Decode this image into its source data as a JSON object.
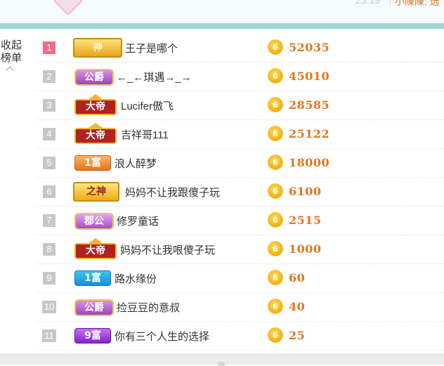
{
  "header": {
    "time": "23:19",
    "user": "小陳陳: 选"
  },
  "collapse": {
    "line1": "收起",
    "line2": "榜单"
  },
  "rows": [
    {
      "rank": "1",
      "badge": "神",
      "badge_type": "gold",
      "name": "王子是哪个",
      "score": "52035"
    },
    {
      "rank": "2",
      "badge": "公爵",
      "badge_type": "gong",
      "name": "←_←琪遇→_→",
      "score": "45010"
    },
    {
      "rank": "3",
      "badge": "大帝",
      "badge_type": "dadi",
      "name": "Lucifer傲飞",
      "score": "28585"
    },
    {
      "rank": "4",
      "badge": "大帝",
      "badge_type": "dadi",
      "name": "吉祥哥111",
      "score": "25122"
    },
    {
      "rank": "5",
      "badge": "1富",
      "badge_type": "fu1",
      "name": "浪人醉梦",
      "score": "18000"
    },
    {
      "rank": "6",
      "badge": "之神",
      "badge_type": "zhishen",
      "name": "妈妈不让我跟傻子玩",
      "score": "6100"
    },
    {
      "rank": "7",
      "badge": "郡公",
      "badge_type": "jun",
      "name": "修罗童话",
      "score": "2515"
    },
    {
      "rank": "8",
      "badge": "大帝",
      "badge_type": "dadi",
      "name": "妈妈不让我哏傻子玩",
      "score": "1000"
    },
    {
      "rank": "9",
      "badge": "1富",
      "badge_type": "fu1b",
      "name": "路水缘份",
      "score": "60"
    },
    {
      "rank": "10",
      "badge": "公爵",
      "badge_type": "gong",
      "name": "捡豆豆的意叔",
      "score": "40"
    },
    {
      "rank": "11",
      "badge": "9富",
      "badge_type": "fu9",
      "name": "你有三个人生的选择",
      "score": "25"
    }
  ],
  "coin_glyph": "6",
  "colors": {
    "accent_bar": "#a0d5d0",
    "rank1": "#f46a86",
    "rank_default": "#c7c7c7",
    "score": "#e0761d",
    "coin": "#f4b00e"
  }
}
